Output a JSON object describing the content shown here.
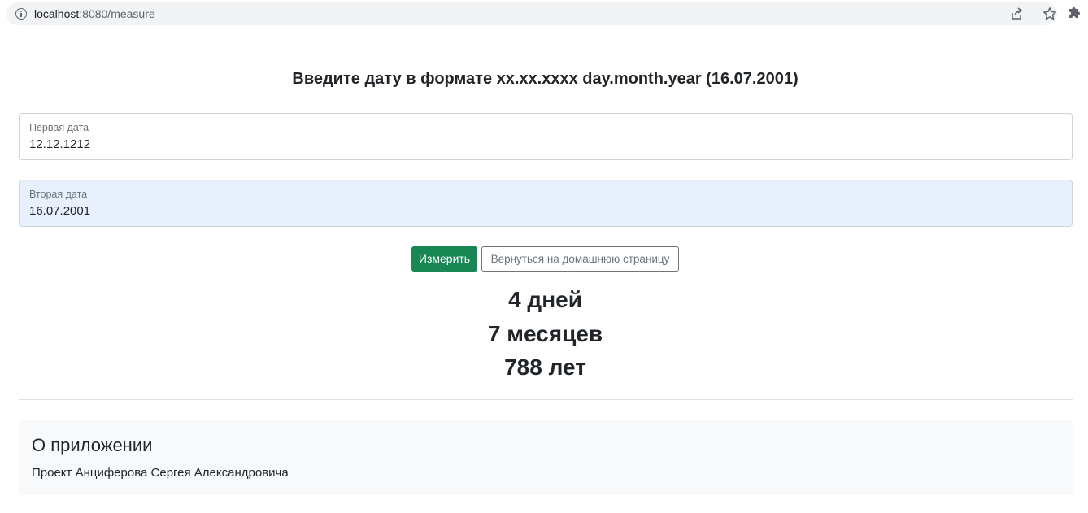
{
  "browser": {
    "url_host": "localhost",
    "url_rest": ":8080/measure",
    "icons": [
      "info-icon",
      "share-icon",
      "star-icon",
      "extension-icon"
    ]
  },
  "page": {
    "heading": "Введите дату в формате xx.xx.xxxx day.month.year (16.07.2001)",
    "first_date": {
      "label": "Первая дата",
      "value": "12.12.1212"
    },
    "second_date": {
      "label": "Вторая дата",
      "value": "16.07.2001"
    },
    "buttons": {
      "measure": "Измерить",
      "home": "Вернуться на домашнюю страницу"
    },
    "result": {
      "days": "4 дней",
      "months": "7 месяцев",
      "years": "788 лет"
    },
    "about": {
      "title": "О приложении",
      "text": "Проект Анциферова Сергея Александровича"
    }
  },
  "colors": {
    "primary_button": "#198754",
    "secondary_button": "#6c757d",
    "autofill_background": "#e8f0fe"
  }
}
